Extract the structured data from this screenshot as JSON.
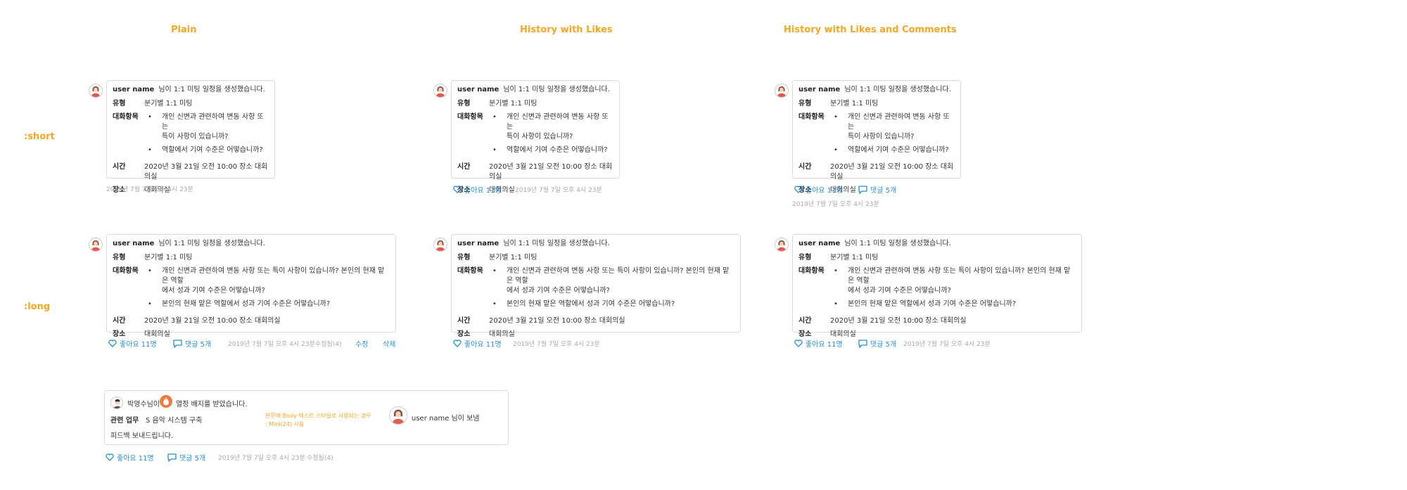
{
  "columns": [
    "Plain",
    "History with Likes",
    "History with Likes and Comments"
  ],
  "rows": [
    ":short",
    ":long"
  ],
  "card": {
    "user_name": "user name",
    "header_text": "님이 1:1 미팅 일정을 생성했습니다.",
    "type_label": "유형",
    "type_value": "분기별 1:1 미팅",
    "topics_label": "대화항목",
    "short_topics": [
      "개인 신변과 관련하여 변동 사항 또는\n특이 사항이 있습니까?",
      "역할에서 기여 수준은 어떻습니까?"
    ],
    "long_topics": [
      "개인 신변과 관련하여 변동 사항 또는 특이 사항이 있습니까? 본인의 현재 맡은 역할\n에서 성과 기여 수준은 어떻습니까?",
      "본인의 현재 맡은 역할에서 성과 기여 수준은 어떻습니까?"
    ],
    "time_label": "시간",
    "time_value": "2020년 3월 21일 오전 10:00 장소 대회의실",
    "place_label": "장소",
    "place_value": "대회의실"
  },
  "meta": {
    "timestamp": "2019년 7월 7일 오후 4시 23분",
    "likes": "좋아요 11명",
    "comments": "댓글 5개",
    "edited": "수정됨(4)",
    "edit": "수정",
    "delete": "삭제"
  },
  "badge": {
    "user": "박영수님이",
    "text": "열정 배지를 받았습니다.",
    "related_label": "관련 업무",
    "related_value": "S 음악 시스템 구축",
    "feedback": "피드백 보내드립니다.",
    "note_line1": "본문에 Body 텍스트 스타일로 사용되는 경우",
    "note_line2": ": Mini(24) 사용",
    "sender": "user name 님이 보냄"
  },
  "colors": {
    "accent": "#f5a623",
    "link": "#2a8dd4",
    "border": "#dcdcdc"
  }
}
